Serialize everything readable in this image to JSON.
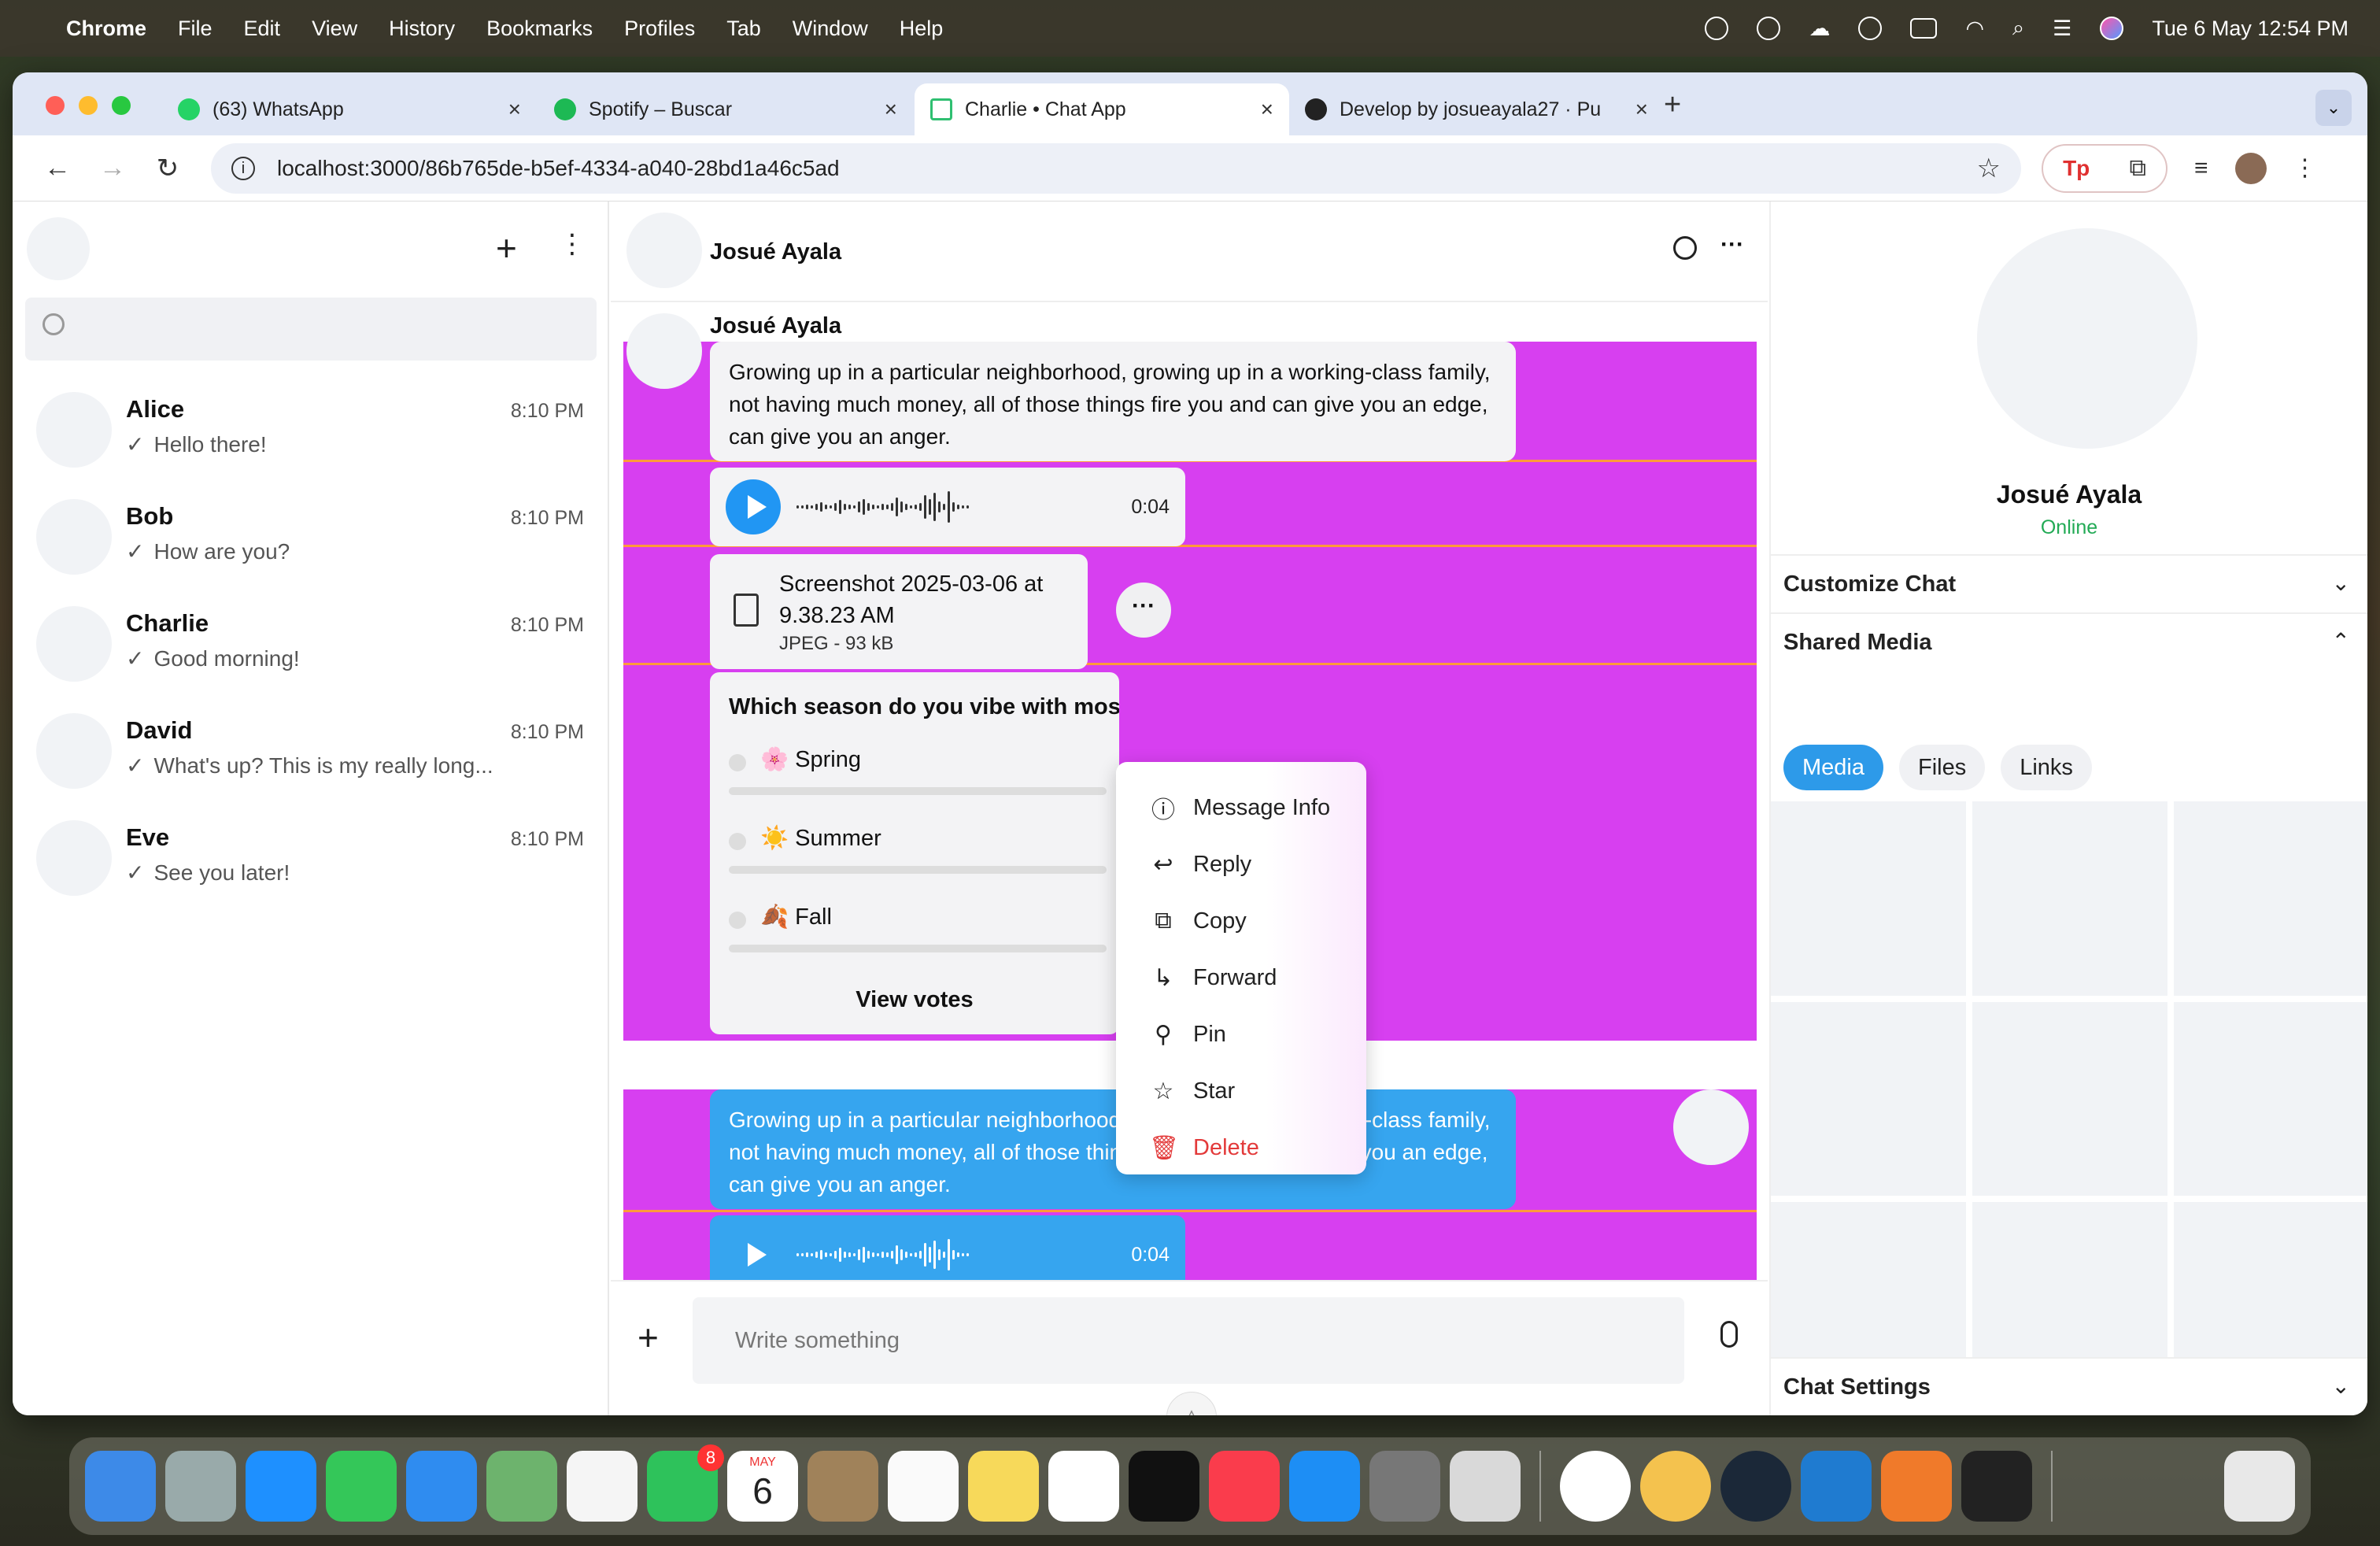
{
  "menubar": {
    "app": "Chrome",
    "items": [
      "File",
      "Edit",
      "View",
      "History",
      "Bookmarks",
      "Profiles",
      "Tab",
      "Window",
      "Help"
    ],
    "clock": "Tue 6 May  12:54 PM"
  },
  "browser": {
    "tabs": [
      {
        "title": "(63) WhatsApp",
        "color": "#25d366"
      },
      {
        "title": "Spotify – Buscar",
        "color": "#1db954"
      },
      {
        "title": "Charlie • Chat App",
        "color": "#2fbf71"
      },
      {
        "title": "Develop by josueayala27 · Pu",
        "color": "#222222"
      }
    ],
    "url": "localhost:3000/86b765de-b5ef-4334-a040-28bd1a46c5ad",
    "ext_label": "Tp"
  },
  "sidebar": {
    "contacts": [
      {
        "name": "Alice",
        "time": "8:10 PM",
        "last": "Hello there!"
      },
      {
        "name": "Bob",
        "time": "8:10 PM",
        "last": "How are you?"
      },
      {
        "name": "Charlie",
        "time": "8:10 PM",
        "last": "Good morning!"
      },
      {
        "name": "David",
        "time": "8:10 PM",
        "last": "What's up? This is my really long..."
      },
      {
        "name": "Eve",
        "time": "8:10 PM",
        "last": "See you later!"
      }
    ]
  },
  "chat": {
    "title": "Josué Ayala",
    "sender": "Josué Ayala",
    "message_text": "Growing up in a particular neighborhood, growing up in a working-class family, not having much money, all of those things fire you and can give you an edge, can give you an anger.",
    "audio_duration": "0:04",
    "file": {
      "name": "Screenshot 2025-03-06 at 9.38.23 AM",
      "meta": "JPEG - 93 kB"
    },
    "poll": {
      "question": "Which season do you vibe with mos",
      "options": [
        "🌸 Spring",
        "☀️ Summer",
        "🍂 Fall"
      ],
      "view_votes": "View votes"
    },
    "out_message_text": "Growing up in a particular neighborhood, growing up in a working-class family, not having much money, all of those things fire you and can give you an edge, can give you an anger.",
    "composer_placeholder": "Write something"
  },
  "context_menu": {
    "items": [
      {
        "label": "Message Info",
        "icon": "info-icon"
      },
      {
        "label": "Reply",
        "icon": "reply-icon"
      },
      {
        "label": "Copy",
        "icon": "copy-icon"
      },
      {
        "label": "Forward",
        "icon": "forward-icon"
      },
      {
        "label": "Pin",
        "icon": "pin-icon"
      },
      {
        "label": "Star",
        "icon": "star-icon"
      },
      {
        "label": "Delete",
        "icon": "trash-icon"
      }
    ]
  },
  "right_panel": {
    "name": "Josué Ayala",
    "status": "Online",
    "sections": {
      "customize": "Customize Chat",
      "shared": "Shared Media",
      "settings": "Chat Settings"
    },
    "tabs": [
      "Media",
      "Files",
      "Links"
    ]
  },
  "dock": {
    "calendar_month": "MAY",
    "calendar_day": "6",
    "facetime_badge": "8"
  },
  "colors": {
    "highlight_band": "#d73ff0",
    "separator": "#ff9a3a",
    "outgoing_bubble": "#36a5ef",
    "accent": "#2d9ae9",
    "online": "#22aa55",
    "danger": "#e33a3a"
  }
}
